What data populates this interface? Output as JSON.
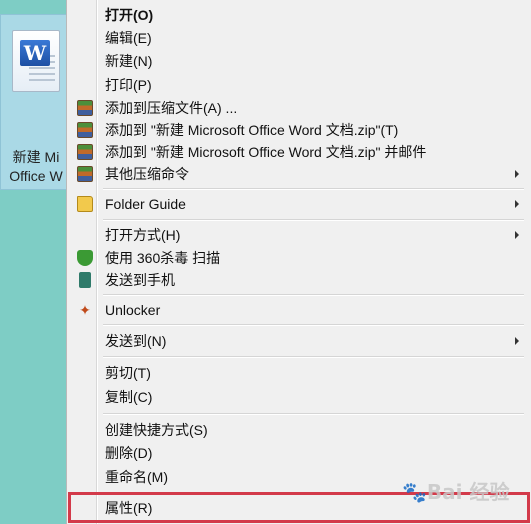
{
  "desktop": {
    "icon_name": "word-document-icon",
    "label_line1": "新建 Mi",
    "label_line2": "Office W"
  },
  "context_menu": {
    "items": [
      {
        "label": "打开(O)",
        "bold": true
      },
      {
        "label": "编辑(E)"
      },
      {
        "label": "新建(N)"
      },
      {
        "label": "打印(P)"
      },
      {
        "label": "添加到压缩文件(A) ...",
        "icon": "winrar-icon"
      },
      {
        "label": "添加到 \"新建 Microsoft Office Word 文档.zip\"(T)",
        "icon": "winrar-icon"
      },
      {
        "label": "添加到 \"新建 Microsoft Office Word 文档.zip\" 并邮件",
        "icon": "winrar-icon"
      },
      {
        "label": "其他压缩命令",
        "icon": "winrar-icon",
        "submenu": true
      },
      {
        "label": "Folder Guide",
        "icon": "folder-icon",
        "submenu": true
      },
      {
        "label": "打开方式(H)",
        "submenu": true
      },
      {
        "label": "使用 360杀毒 扫描",
        "icon": "shield-360-icon"
      },
      {
        "label": "发送到手机",
        "icon": "phone-icon"
      },
      {
        "label": "Unlocker",
        "icon": "magic-wand-icon"
      },
      {
        "label": "发送到(N)",
        "submenu": true
      },
      {
        "label": "剪切(T)"
      },
      {
        "label": "复制(C)"
      },
      {
        "label": "创建快捷方式(S)"
      },
      {
        "label": "删除(D)"
      },
      {
        "label": "重命名(M)"
      },
      {
        "label": "属性(R)",
        "highlighted": true
      }
    ]
  },
  "watermark": {
    "text": "Bai 经验"
  },
  "colors": {
    "desktop": "#7ecdc5",
    "menu_bg": "#f0f0f0",
    "highlight_border": "#d33a4a"
  }
}
